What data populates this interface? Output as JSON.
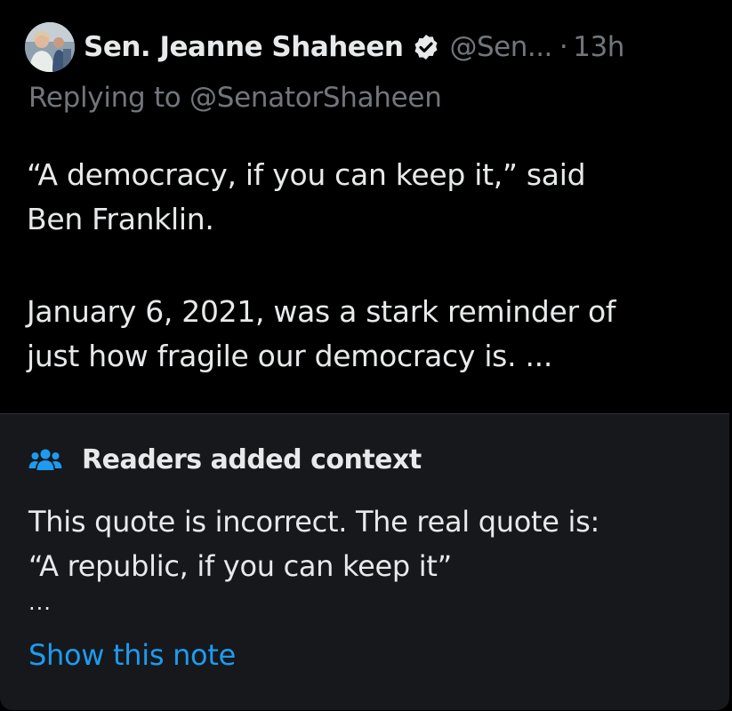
{
  "tweet": {
    "author": {
      "name": "Sen. Jeanne Shaheen",
      "handle": "@Sen...",
      "separator": "·",
      "time": "13h",
      "avatar_icon": "avatar-photo",
      "verified_icon": "verified-badge-icon"
    },
    "replying_to": "Replying to @SenatorShaheen",
    "body": {
      "paragraph_1_line_1": "“A democracy, if you can keep it,” said",
      "paragraph_1_line_2": "Ben Franklin.",
      "paragraph_2_line_1": "January 6, 2021, was a stark reminder of",
      "paragraph_2_line_2": "just how fragile our democracy is.  ..."
    }
  },
  "community_note": {
    "icon": "people-icon",
    "title": "Readers added context",
    "text_line_1": "This quote is incorrect. The real quote is:",
    "text_line_2": "“A republic, if you can keep it”",
    "ellipsis": "...",
    "show_link": "Show this note"
  },
  "colors": {
    "background": "#000000",
    "note_background": "#16181c",
    "primary_text": "#e7e9ea",
    "secondary_text": "#71767b",
    "link": "#1d9bf0",
    "note_icon": "#1d9bf0",
    "verified_badge": "#e7e9ea"
  }
}
